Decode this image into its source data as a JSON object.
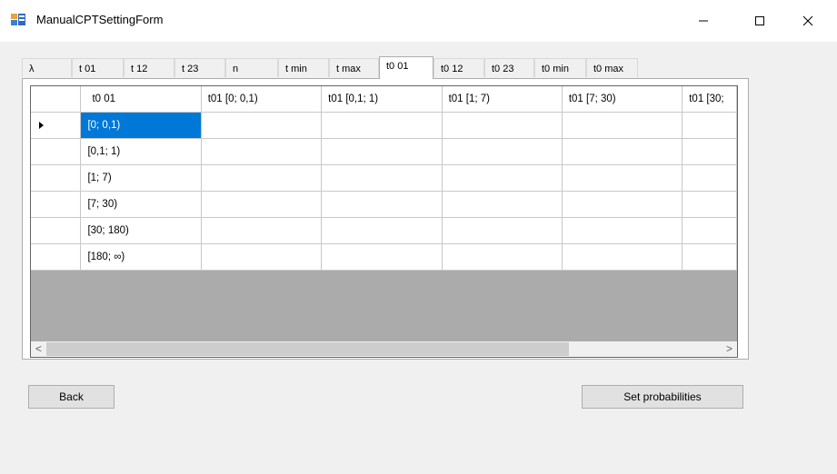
{
  "window": {
    "title": "ManualCPTSettingForm",
    "minimize_glyph": "—",
    "maximize_glyph": "☐",
    "close_glyph": "✕"
  },
  "tabs": [
    {
      "label": "λ"
    },
    {
      "label": "t 01"
    },
    {
      "label": "t 12"
    },
    {
      "label": "t 23"
    },
    {
      "label": "n"
    },
    {
      "label": "t min"
    },
    {
      "label": "t max"
    },
    {
      "label": "t0 01",
      "active": true
    },
    {
      "label": "t0 12"
    },
    {
      "label": "t0 23"
    },
    {
      "label": "t0 min"
    },
    {
      "label": "t0 max"
    }
  ],
  "grid": {
    "columns": [
      "t0 01",
      "t01 [0; 0,1)",
      "t01 [0,1; 1)",
      "t01 [1; 7)",
      "t01 [7; 30)",
      "t01 [30;"
    ],
    "rows": [
      "[0; 0,1)",
      "[0,1; 1)",
      "[1; 7)",
      "[7; 30)",
      "[30; 180)",
      "[180; ∞)"
    ],
    "scroll_left_glyph": "<",
    "scroll_right_glyph": ">"
  },
  "buttons": {
    "back": "Back",
    "set_probabilities": "Set probabilities"
  }
}
